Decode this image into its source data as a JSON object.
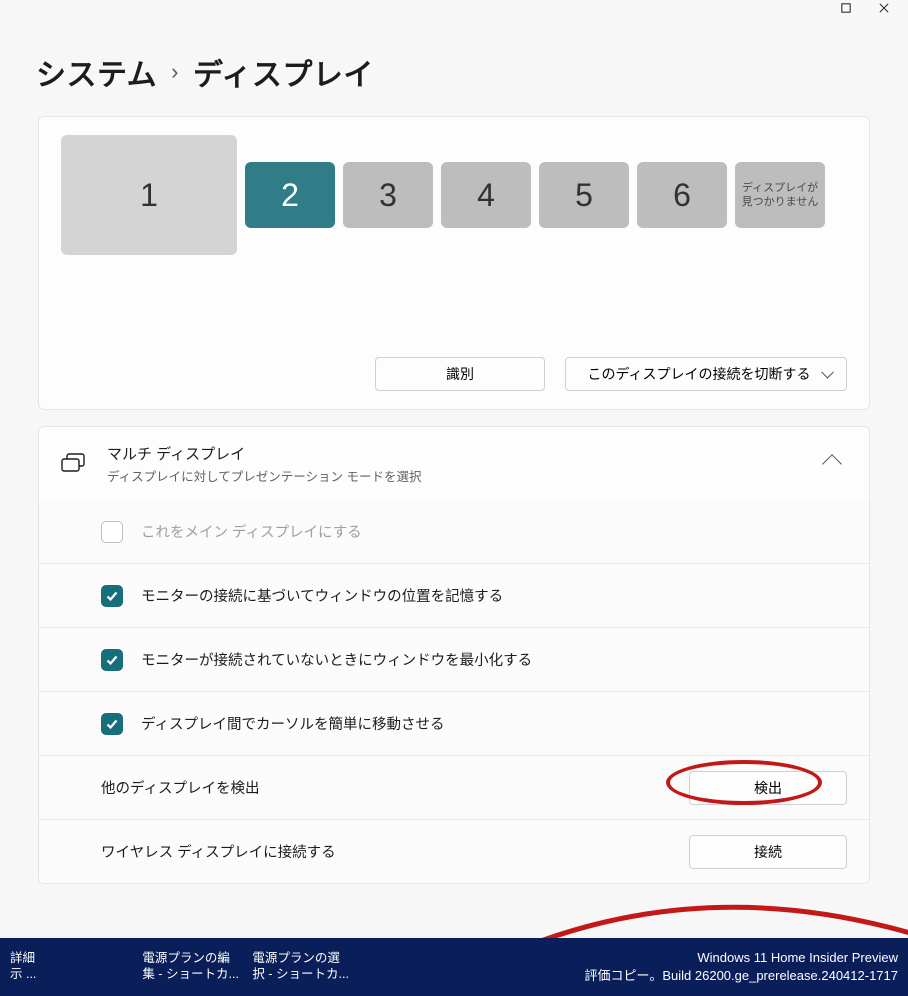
{
  "breadcrumb": {
    "parent": "システム",
    "current": "ディスプレイ"
  },
  "monitors": {
    "m1": "1",
    "m2": "2",
    "m3": "3",
    "m4": "4",
    "m5": "5",
    "m6": "6",
    "notfound": "ディスプレイが見つかりません"
  },
  "arrange": {
    "identify": "識別",
    "disconnect": "このディスプレイの接続を切断する"
  },
  "multi": {
    "title": "マルチ ディスプレイ",
    "subtitle": "ディスプレイに対してプレゼンテーション モードを選択"
  },
  "options": {
    "make_main": "これをメイン ディスプレイにする",
    "remember_pos": "モニターの接続に基づいてウィンドウの位置を記憶する",
    "minimize": "モニターが接続されていないときにウィンドウを最小化する",
    "easy_cursor": "ディスプレイ間でカーソルを簡単に移動させる",
    "detect_other": "他のディスプレイを検出",
    "detect_btn": "検出",
    "wireless": "ワイヤレス ディスプレイに接続する",
    "connect_btn": "接続"
  },
  "taskbar": {
    "i1": "詳細\n示 ...",
    "i2": "電源プランの編\n集 - ショートカ...",
    "i3": "電源プランの選\n択 - ショートカ...",
    "r1": "Windows 11 Home Insider Preview",
    "r2": "評価コピー。Build 26200.ge_prerelease.240412-1717"
  }
}
